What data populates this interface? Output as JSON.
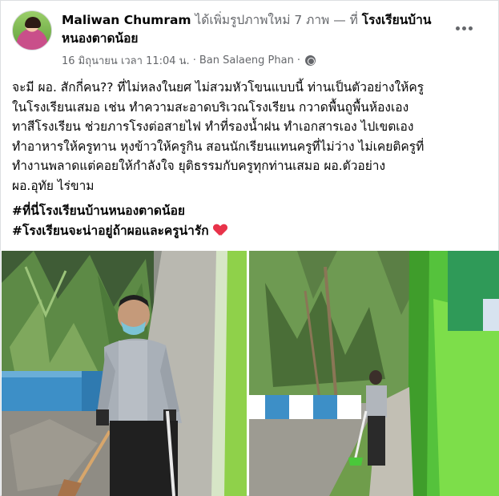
{
  "post": {
    "author": "Maliwan Chumram",
    "action": "ได้เพิ่มรูปภาพใหม่ 7 ภาพ — ที่",
    "place": "โรงเรียนบ้านหนองตาดน้อย",
    "timestamp": "16 มิถุนายน เวลา 11:04 น.",
    "separator": "·",
    "location": "Ban Salaeng Phan",
    "separator2": "·",
    "body": "จะมี ผอ. สักกี่คน?? ที่ไม่หลงในยศ ไม่สวมหัวโขนแบบนี้ ท่านเป็นตัวอย่างให้ครู\nในโรงเรียนเสมอ เช่น ทำความสะอาดบริเวณโรงเรียน กวาดพื้นถูพื้นห้องเอง\nทาสีโรงเรียน ช่วยภารโรงต่อสายไฟ ทำที่รองน้ำฝน ทำเอกสารเอง ไปเขตเอง\nทำอาหารให้ครูทาน หุงข้าวให้ครูกิน สอนนักเรียนแทนครูที่ไม่ว่าง ไม่เคยติครูที่\nทำงานพลาดแต่คอยให้กำลังใจ ยุติธรรมกับครูทุกท่านเสมอ ผอ.ตัวอย่าง\nผอ.อุทัย ไร่ขาม",
    "hashtags": [
      "#ที่นี่โรงเรียนบ้านหนองตาดน้อย",
      "#โรงเรียนจะน่าอยู่ถ้าผอและครูน่ารัก"
    ],
    "icons": {
      "more": "more-options-icon",
      "privacy": "globe-icon",
      "emoji": "heart-emoji"
    },
    "colors": {
      "text": "#050505",
      "secondary": "#65676b",
      "heart": "#e8334a"
    }
  }
}
